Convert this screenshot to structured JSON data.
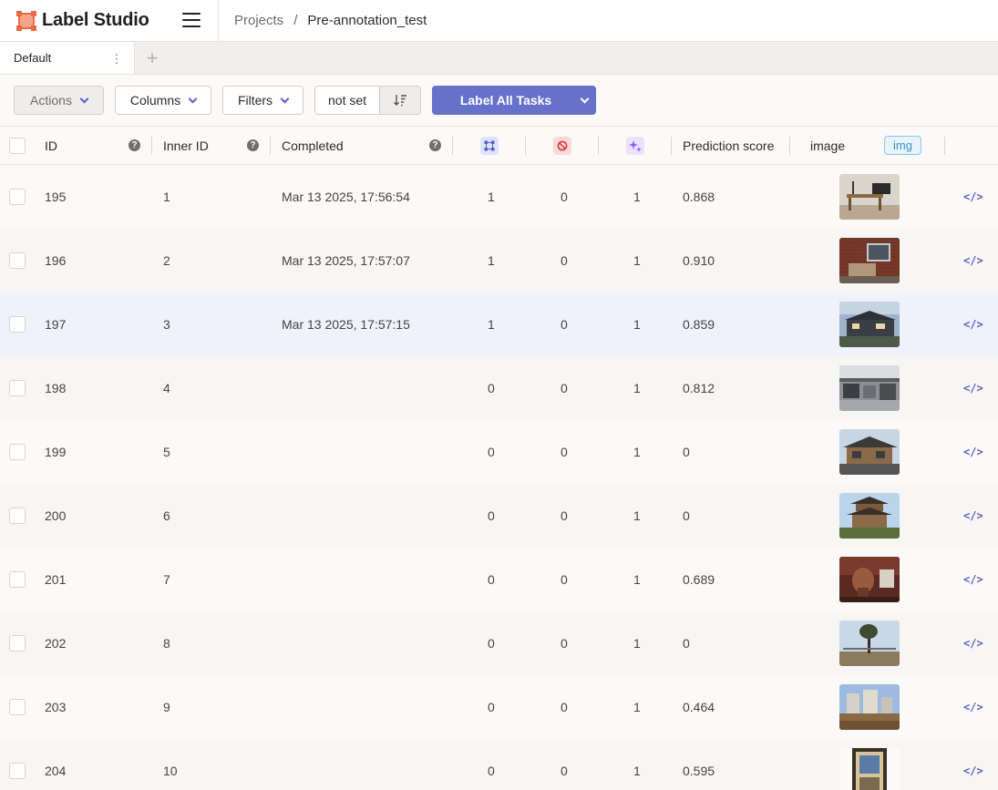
{
  "app": {
    "name": "Label Studio"
  },
  "breadcrumb": {
    "projects": "Projects",
    "separator": "/",
    "current": "Pre-annotation_test"
  },
  "tabs": [
    {
      "label": "Default"
    }
  ],
  "toolbar": {
    "actions": "Actions",
    "columns": "Columns",
    "filters": "Filters",
    "sort_value": "not set",
    "label_all": "Label All Tasks",
    "accent": "#6672c9"
  },
  "columns": {
    "id": "ID",
    "inner_id": "Inner ID",
    "completed": "Completed",
    "prediction_score": "Prediction score",
    "image": "image",
    "image_tag": "img",
    "icons": [
      "annotations-icon",
      "cancelled-icon",
      "predictions-icon"
    ]
  },
  "rows": [
    {
      "id": "195",
      "inner_id": "1",
      "completed": "Mar 13 2025, 17:56:54",
      "annotations": "1",
      "cancelled": "0",
      "predictions": "1",
      "score": "0.868",
      "thumb": "interior"
    },
    {
      "id": "196",
      "inner_id": "2",
      "completed": "Mar 13 2025, 17:57:07",
      "annotations": "1",
      "cancelled": "0",
      "predictions": "1",
      "score": "0.910",
      "thumb": "brick"
    },
    {
      "id": "197",
      "inner_id": "3",
      "completed": "Mar 13 2025, 17:57:15",
      "annotations": "1",
      "cancelled": "0",
      "predictions": "1",
      "score": "0.859",
      "thumb": "house-dark"
    },
    {
      "id": "198",
      "inner_id": "4",
      "completed": "",
      "annotations": "0",
      "cancelled": "0",
      "predictions": "1",
      "score": "0.812",
      "thumb": "factory"
    },
    {
      "id": "199",
      "inner_id": "5",
      "completed": "",
      "annotations": "0",
      "cancelled": "0",
      "predictions": "1",
      "score": "0",
      "thumb": "house-wood"
    },
    {
      "id": "200",
      "inner_id": "6",
      "completed": "",
      "annotations": "0",
      "cancelled": "0",
      "predictions": "1",
      "score": "0",
      "thumb": "pagoda"
    },
    {
      "id": "201",
      "inner_id": "7",
      "completed": "",
      "annotations": "0",
      "cancelled": "0",
      "predictions": "1",
      "score": "0.689",
      "thumb": "bathroom"
    },
    {
      "id": "202",
      "inner_id": "8",
      "completed": "",
      "annotations": "0",
      "cancelled": "0",
      "predictions": "1",
      "score": "0",
      "thumb": "tree"
    },
    {
      "id": "203",
      "inner_id": "9",
      "completed": "",
      "annotations": "0",
      "cancelled": "0",
      "predictions": "1",
      "score": "0.464",
      "thumb": "construction"
    },
    {
      "id": "204",
      "inner_id": "10",
      "completed": "",
      "annotations": "0",
      "cancelled": "0",
      "predictions": "1",
      "score": "0.595",
      "thumb": "doorway"
    }
  ]
}
